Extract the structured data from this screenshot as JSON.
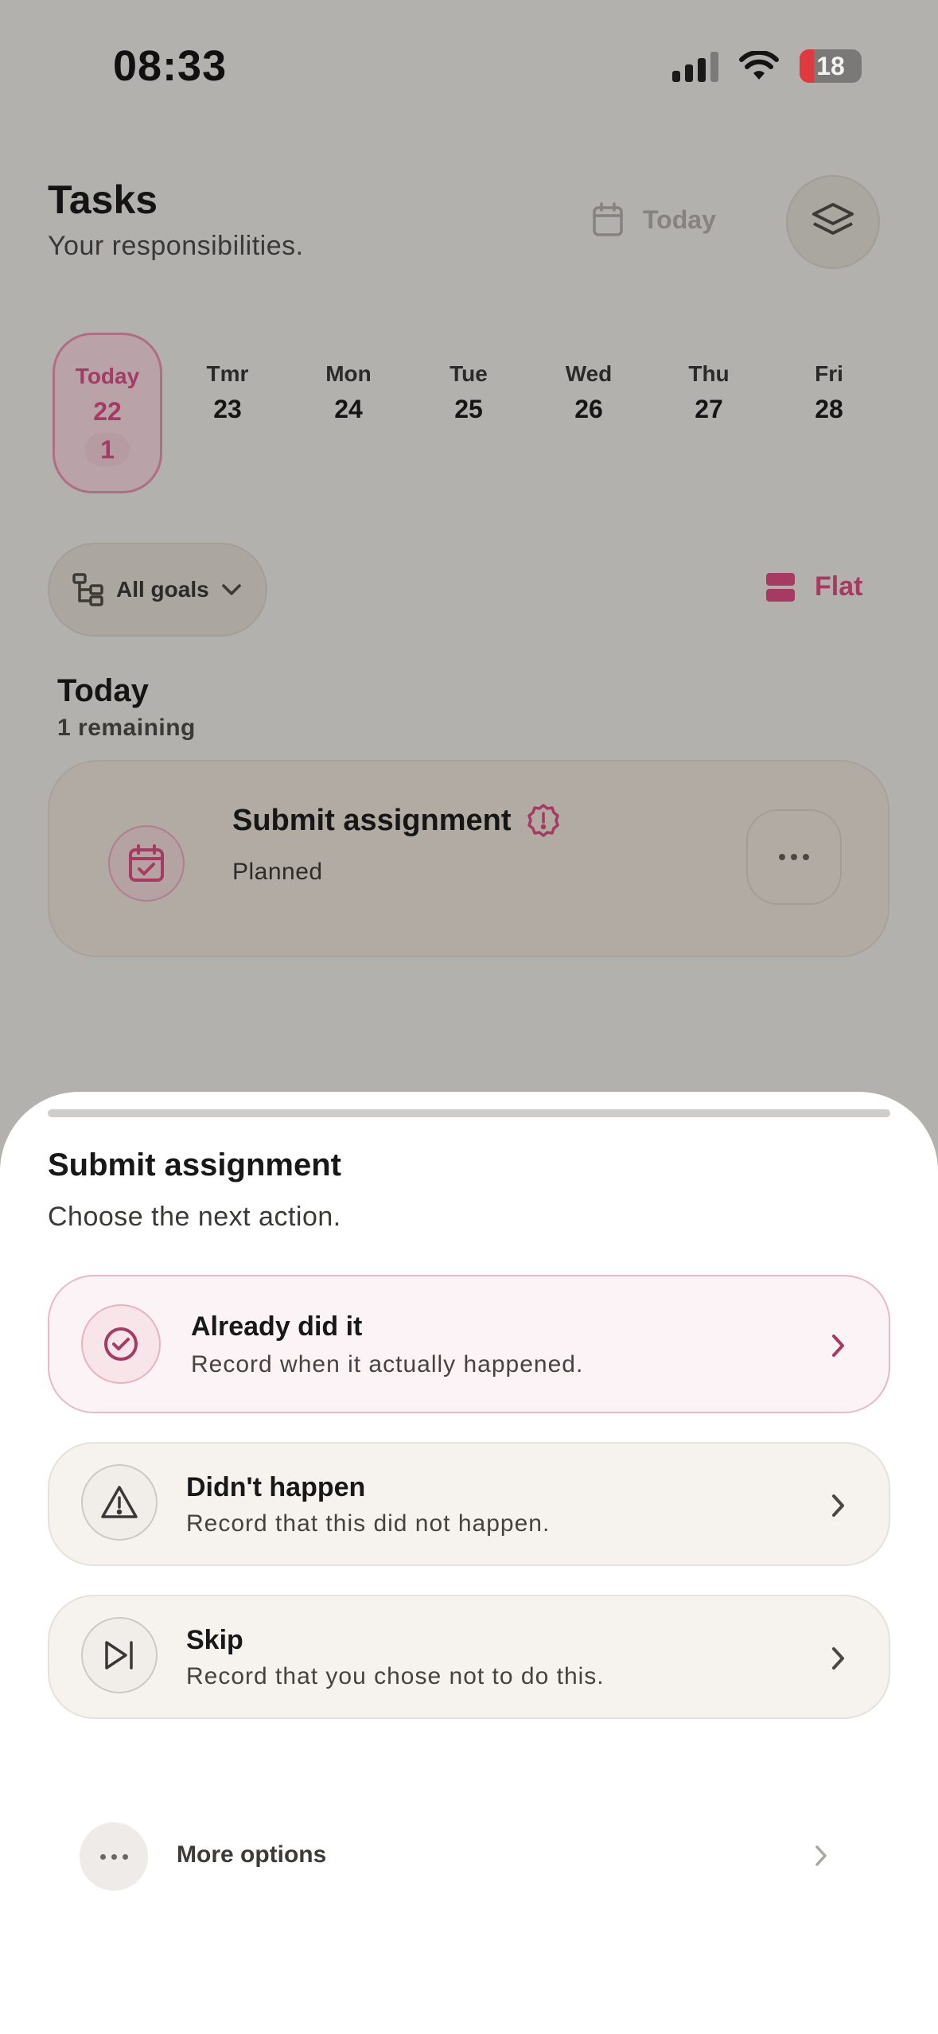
{
  "status_bar": {
    "time": "08:33",
    "battery": "18"
  },
  "header": {
    "title": "Tasks",
    "subtitle": "Your responsibilities.",
    "today_button": "Today"
  },
  "days": [
    {
      "name": "Today",
      "num": "22",
      "count": "1",
      "selected": true
    },
    {
      "name": "Tmr",
      "num": "23"
    },
    {
      "name": "Mon",
      "num": "24"
    },
    {
      "name": "Tue",
      "num": "25"
    },
    {
      "name": "Wed",
      "num": "26"
    },
    {
      "name": "Thu",
      "num": "27"
    },
    {
      "name": "Fri",
      "num": "28"
    }
  ],
  "filters": {
    "goals_label": "All goals",
    "view_label": "Flat"
  },
  "section": {
    "title": "Today",
    "subtitle": "1 remaining"
  },
  "task": {
    "title": "Submit assignment",
    "status": "Planned"
  },
  "sheet": {
    "title": "Submit assignment",
    "subtitle": "Choose the next action.",
    "options": [
      {
        "label": "Already did it",
        "desc": "Record when it actually happened."
      },
      {
        "label": "Didn't happen",
        "desc": "Record that this did not happen."
      },
      {
        "label": "Skip",
        "desc": "Record that you chose not to do this."
      }
    ],
    "more_label": "More options"
  },
  "colors": {
    "accent": "#a63a63",
    "overlay_bg": "#b3b1ae",
    "sheet_bg": "#ffffff",
    "primary_option_bg": "#fbf3f5",
    "option_bg": "#f6f3ee"
  }
}
